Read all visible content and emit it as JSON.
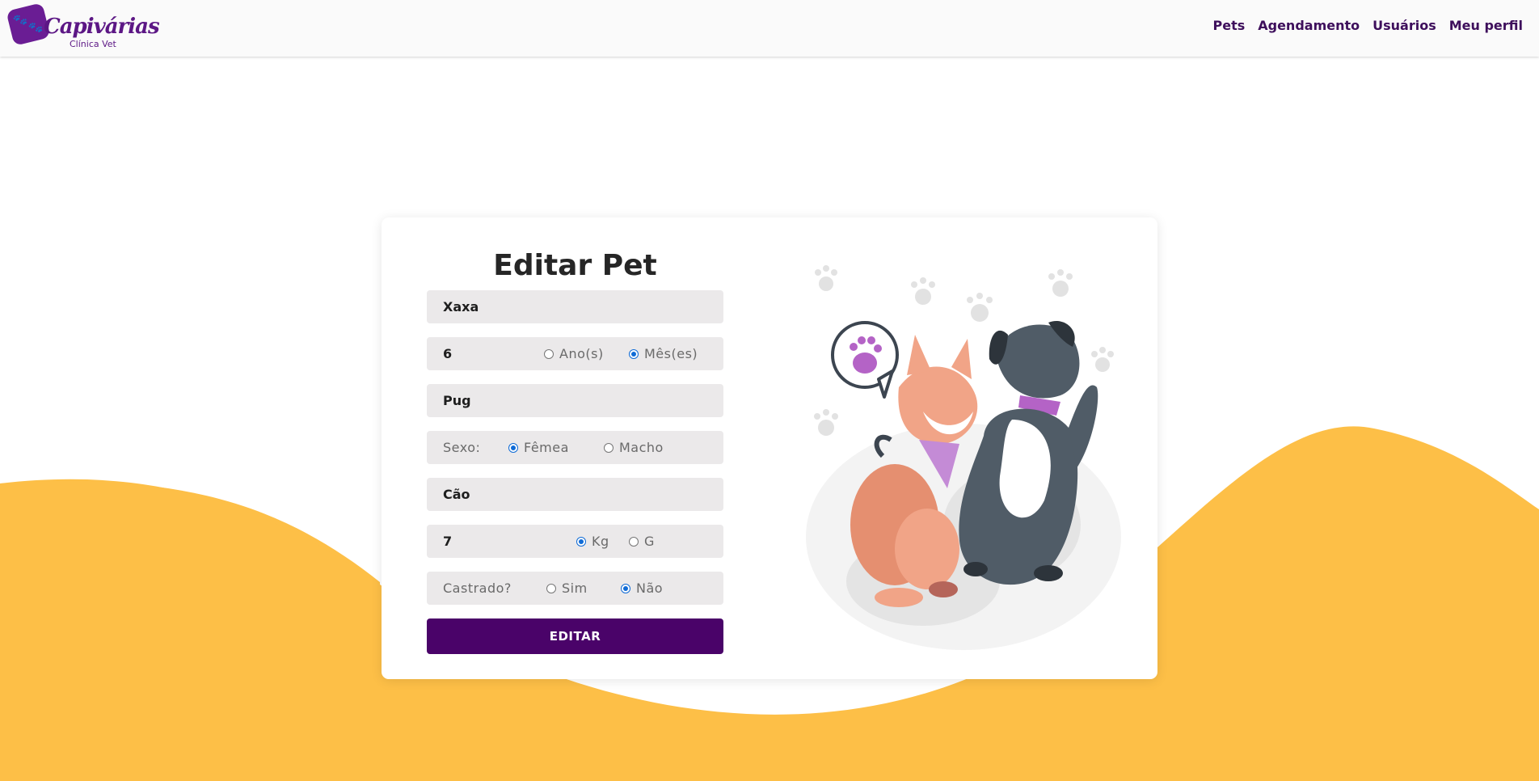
{
  "header": {
    "logo_title": "Capivárias",
    "logo_subtitle": "Clínica Vet",
    "nav": [
      "Pets",
      "Agendamento",
      "Usuários",
      "Meu perfil"
    ]
  },
  "form": {
    "title": "Editar Pet",
    "name_value": "Xaxa",
    "age_value": "6",
    "age_unit_options": [
      "Ano(s)",
      "Mês(es)"
    ],
    "age_unit_selected": "Mês(es)",
    "breed_value": "Pug",
    "sex_label": "Sexo:",
    "sex_options": [
      "Fêmea",
      "Macho"
    ],
    "sex_selected": "Fêmea",
    "species_value": "Cão",
    "weight_value": "7",
    "weight_unit_options": [
      "Kg",
      "G"
    ],
    "weight_unit_selected": "Kg",
    "neutered_label": "Castrado?",
    "neutered_options": [
      "Sim",
      "Não"
    ],
    "neutered_selected": "Não",
    "submit_label": "EDITAR"
  },
  "colors": {
    "brand_purple": "#4a0369",
    "nav_text": "#3e0f5c",
    "wave_yellow": "#fdbf47",
    "field_bg": "#ebe9ea",
    "radio_checked": "#0f6bd6"
  }
}
